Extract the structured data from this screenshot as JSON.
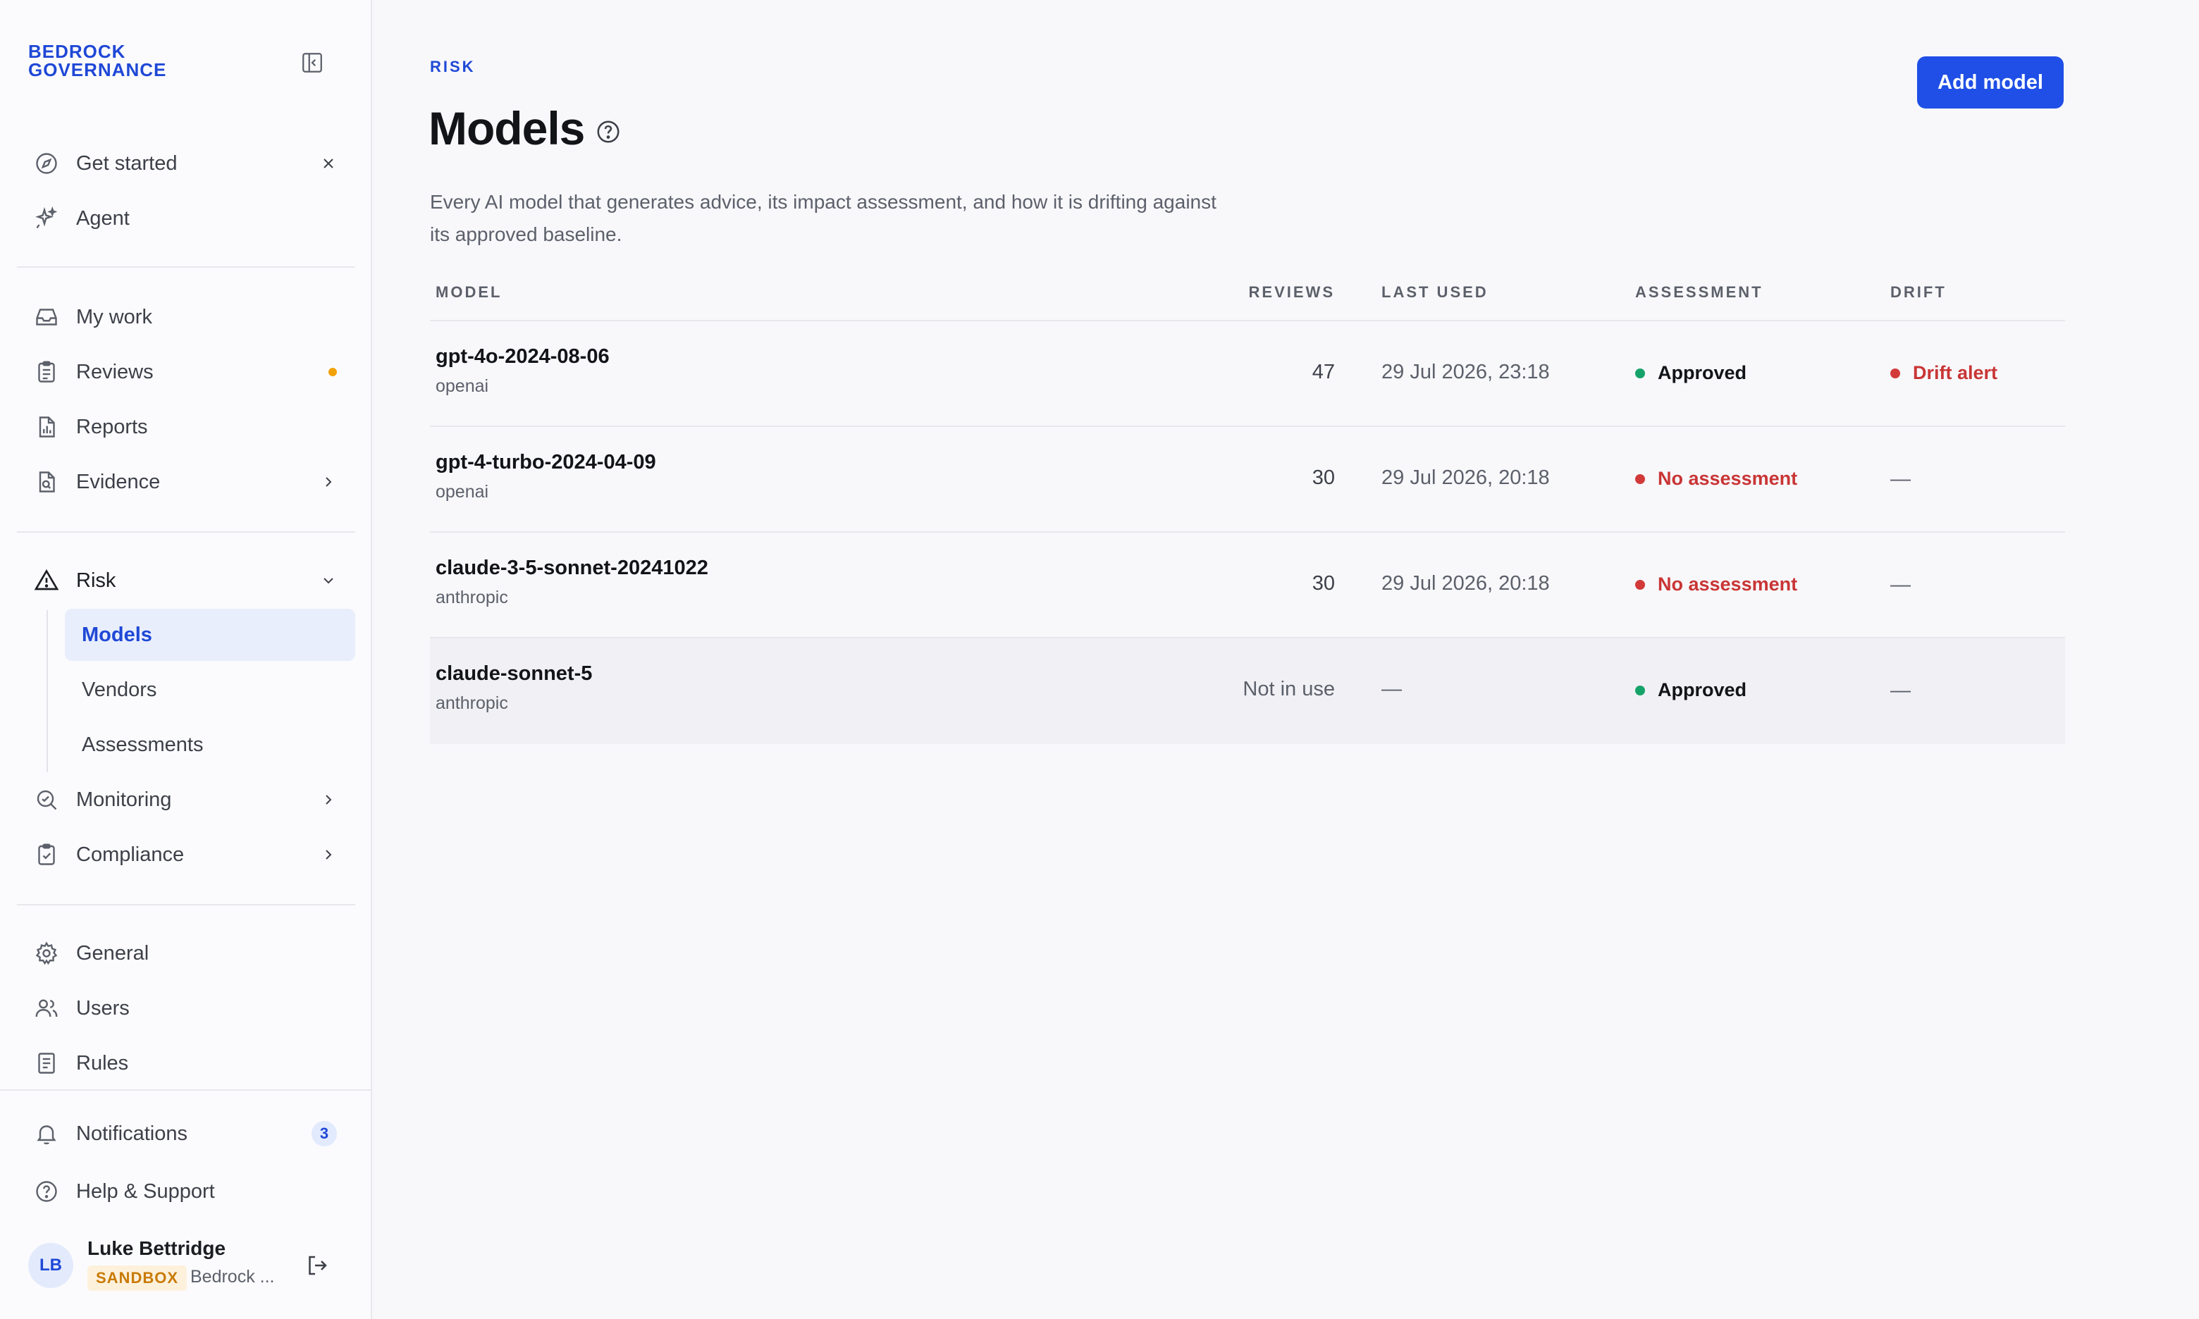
{
  "brand": {
    "line1": "BEDROCK",
    "line2": "GOVERNANCE"
  },
  "sidebar": {
    "top": [
      {
        "label": "Get started"
      },
      {
        "label": "Agent"
      }
    ],
    "work": [
      {
        "label": "My work"
      },
      {
        "label": "Reviews"
      },
      {
        "label": "Reports"
      },
      {
        "label": "Evidence"
      }
    ],
    "risk": {
      "label": "Risk",
      "children": [
        {
          "label": "Models"
        },
        {
          "label": "Vendors"
        },
        {
          "label": "Assessments"
        }
      ]
    },
    "monitoring": {
      "label": "Monitoring"
    },
    "compliance": {
      "label": "Compliance"
    },
    "settings": [
      {
        "label": "General"
      },
      {
        "label": "Users"
      },
      {
        "label": "Rules"
      }
    ],
    "footer": {
      "notifications": {
        "label": "Notifications",
        "count": "3"
      },
      "help": {
        "label": "Help & Support"
      }
    },
    "user": {
      "initials": "LB",
      "name": "Luke Bettridge",
      "badge": "SANDBOX",
      "org": "Bedrock ..."
    }
  },
  "page": {
    "breadcrumb": "RISK",
    "title": "Models",
    "subtitle": "Every AI model that generates advice, its impact assessment, and how it is drifting against its approved baseline.",
    "add_button": "Add model"
  },
  "table": {
    "headers": {
      "model": "MODEL",
      "reviews": "REVIEWS",
      "last_used": "LAST USED",
      "assessment": "ASSESSMENT",
      "drift": "DRIFT"
    },
    "rows": [
      {
        "model": "gpt-4o-2024-08-06",
        "provider": "openai",
        "reviews": "47",
        "last_used": "29 Jul 2026, 23:18",
        "assessment": "Approved",
        "drift": "Drift alert"
      },
      {
        "model": "gpt-4-turbo-2024-04-09",
        "provider": "openai",
        "reviews": "30",
        "last_used": "29 Jul 2026, 20:18",
        "assessment": "No assessment",
        "drift": "—"
      },
      {
        "model": "claude-3-5-sonnet-20241022",
        "provider": "anthropic",
        "reviews": "30",
        "last_used": "29 Jul 2026, 20:18",
        "assessment": "No assessment",
        "drift": "—"
      },
      {
        "model": "claude-sonnet-5",
        "provider": "anthropic",
        "reviews": "Not in use",
        "last_used": "—",
        "assessment": "Approved",
        "drift": "—"
      }
    ]
  },
  "colors": {
    "accent": "#1f4fe6",
    "approved": "#16a36a",
    "alert": "#d23a3a",
    "pending_dot": "#f1a208"
  }
}
